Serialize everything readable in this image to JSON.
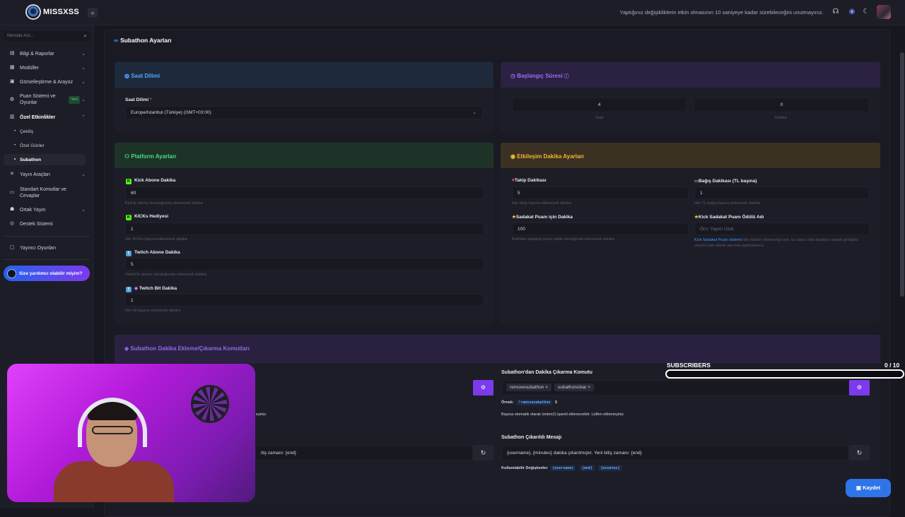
{
  "app": {
    "logo_text": "MISSXSS",
    "notice": "Yaptığınız değişikliklerin etkin olmasının 10 saniyeye kadar sürebileceğini unutmayınız."
  },
  "sidebar": {
    "search_placeholder": "Menüde Ara...",
    "items": [
      {
        "label": "Bilgi & Raporlar"
      },
      {
        "label": "Modüller"
      },
      {
        "label": "Görselleştirme & Arayüz"
      },
      {
        "label": "Puan Sistemi ve Oyunlar",
        "badge": "Yeni"
      },
      {
        "label": "Özel Etkinlikler"
      },
      {
        "label": "Yayın Araçları"
      },
      {
        "label": "Standart Komutlar ve Cevaplar"
      },
      {
        "label": "Ortak Yayın"
      },
      {
        "label": "Destek Sistemi"
      },
      {
        "label": "Yayıncı Oyunları"
      }
    ],
    "subitems": [
      {
        "label": "Çekiliş"
      },
      {
        "label": "Özel Günler"
      },
      {
        "label": "Subathon"
      }
    ],
    "help_button": "Size yardımcı olabilir miyim?"
  },
  "page": {
    "title": "Subathon Ayarları"
  },
  "timezone": {
    "header": "Saat Dilimi",
    "label": "Saat Dilimi",
    "value": "Europe/Istanbul (Türkiye) (GMT+03:00)"
  },
  "start": {
    "header": "Başlangıç Süresi",
    "hours": "4",
    "hours_label": "Saat",
    "minutes": "0",
    "minutes_label": "Dakika"
  },
  "platform": {
    "header": "Platform Ayarları",
    "fields": [
      {
        "label": "Kick Abone Dakika",
        "value": "60",
        "hint": "Kick'te abone olunduğunda eklenecek dakika"
      },
      {
        "label": "KICKs Hediyesi",
        "value": "1",
        "hint": "Her KICKs başına eklenecek dakika"
      },
      {
        "label": "Twitch Abone Dakika",
        "value": "5",
        "hint": "Twitch'te abone olunduğunda eklenecek dakika"
      },
      {
        "label": "Twitch Bit Dakika",
        "value": "1",
        "hint": "Her bit başına eklenecek dakika"
      }
    ]
  },
  "engagement": {
    "header": "Etkileşim Dakika Ayarları",
    "follow_label": "Takip Dakikası",
    "follow_value": "5",
    "follow_hint": "Her takip başına eklenecek dakika",
    "donation_label": "Bağış Dakikası (TL başına)",
    "donation_value": "1",
    "donation_hint": "Her TL bağış başına eklenecek dakika",
    "loyalty_label": "Sadakat Puanı için Dakika",
    "loyalty_value": "100",
    "loyalty_hint": "Belirtilen sadakat puanı ödülü alındığında eklenecek dakika",
    "reward_label": "Kick Sadakat Puanı Ödülü Adı",
    "reward_placeholder": "Örn: Yayını Uzat",
    "reward_hint_link": "Kick Sadakat Puanı sistemi",
    "reward_hint_text": "'nde ödülün ekleneceği isim; bu alana ödül başlığını olarak girdiğiniz yazının tam olarak aynısını yazmalısınız."
  },
  "commands": {
    "header": "Subathon Dakika Ekleme/Çıkarma Komutları",
    "left_warning_tail": "eyiniz.",
    "left_message_tail": "itiş zamanı: {end}",
    "remove_title": "Subathon'dan Dakika Çıkarma Komutu",
    "remove_tags": [
      "removesubathon",
      "subathoncikar"
    ],
    "example_label": "Örnek:",
    "example_code": "!removesubathon",
    "example_value": "5",
    "warning": "Başına otomatik olarak ünlem(!) işareti eklenecektir. Lütfen eklemeyiniz.",
    "removed_title": "Subathon Çıkarıldı Mesajı",
    "removed_message": "{username}, {minutes} dakika çıkarılmıştır. Yeni bitiş zamanı: {end}",
    "vars_label": "Kullanılabilir Değişkenler",
    "vars": [
      "{username}",
      "{end}",
      "{minutes}"
    ]
  },
  "overlay": {
    "title": "SUBSCRIBERS",
    "count": "0 / 10",
    "progress": 0
  },
  "save_button": "Kaydet",
  "colors": {
    "accent_purple": "#7c3aed",
    "accent_blue": "#2f74e8",
    "kick_green": "#53fc18"
  }
}
